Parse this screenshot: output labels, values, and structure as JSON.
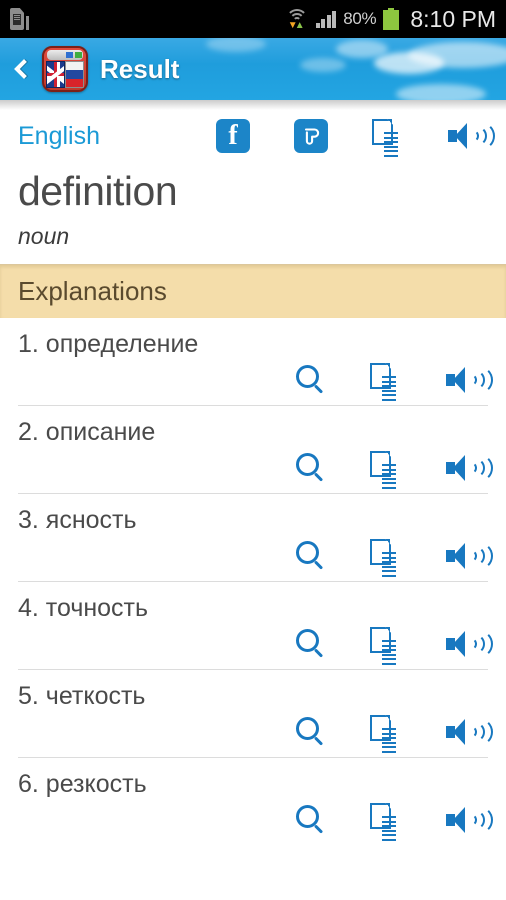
{
  "statusbar": {
    "sim_icon": "sim-card-alert-icon",
    "wifi_icon": "wifi-icon",
    "signal_icon": "cellular-signal-icon",
    "battery_percent": "80%",
    "battery_icon": "battery-icon",
    "clock": "8:10 PM"
  },
  "titlebar": {
    "back_icon": "back-chevron-icon",
    "app_icon": "dictionary-app-icon",
    "title": "Result"
  },
  "actions": {
    "language": "English",
    "facebook_icon": "facebook-icon",
    "facebook_glyph": "f",
    "twitter_icon": "twitter-icon",
    "copy_icon": "copy-icon",
    "speak_icon": "speaker-icon"
  },
  "word": {
    "headword": "definition",
    "part_of_speech": "noun"
  },
  "section": {
    "title": "Explanations"
  },
  "entries": [
    {
      "text": "1. определение"
    },
    {
      "text": "2. описание"
    },
    {
      "text": "3. ясность"
    },
    {
      "text": "4. точность"
    },
    {
      "text": "5. четкость"
    },
    {
      "text": "6. резкость"
    }
  ],
  "row_icons": {
    "search": "search-icon",
    "copy": "copy-icon",
    "speak": "speaker-icon"
  },
  "colors": {
    "accent_blue": "#1878c0",
    "link_blue": "#1b9ad6",
    "header_sky": "#23a5e2",
    "section_bg": "#f4ddaa",
    "text_dark": "#4a4a4a"
  }
}
